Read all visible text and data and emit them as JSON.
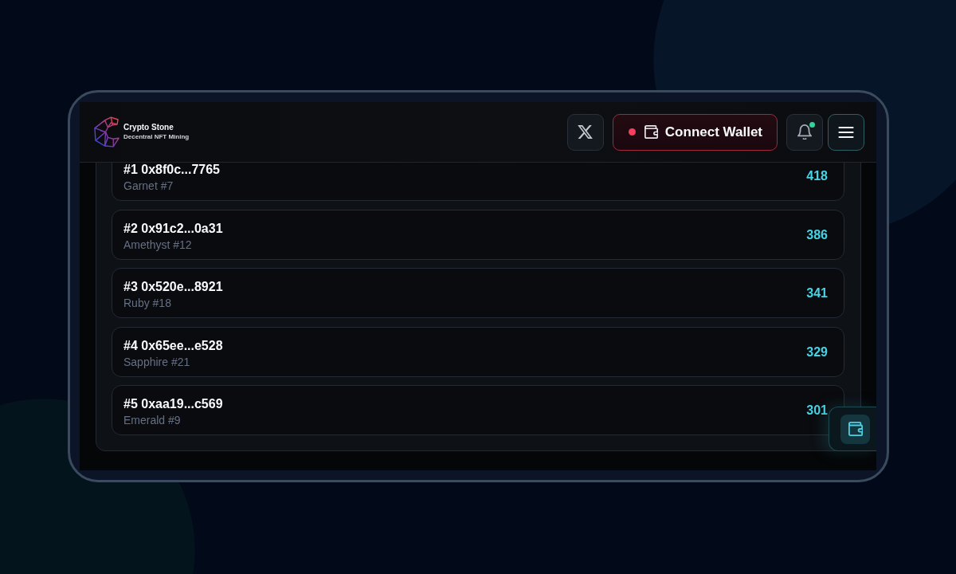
{
  "header": {
    "brand": {
      "name": "Crypto Stone",
      "tagline": "Decentral NFT Mining"
    },
    "wallet": {
      "label": "Connect Wallet",
      "connected": false
    },
    "notifications": {
      "unread": true
    }
  },
  "leaderboard": {
    "rows": [
      {
        "player": "#1 0x8f0c...7765",
        "nft": "Garnet #7",
        "points": "418"
      },
      {
        "player": "#2 0x91c2...0a31",
        "nft": "Amethyst #12",
        "points": "386"
      },
      {
        "player": "#3 0x520e...8921",
        "nft": "Ruby #18",
        "points": "341"
      },
      {
        "player": "#4 0x65ee...e528",
        "nft": "Sapphire #21",
        "points": "329"
      },
      {
        "player": "#5 0xaa19...c569",
        "nft": "Emerald #9",
        "points": "301"
      }
    ]
  }
}
